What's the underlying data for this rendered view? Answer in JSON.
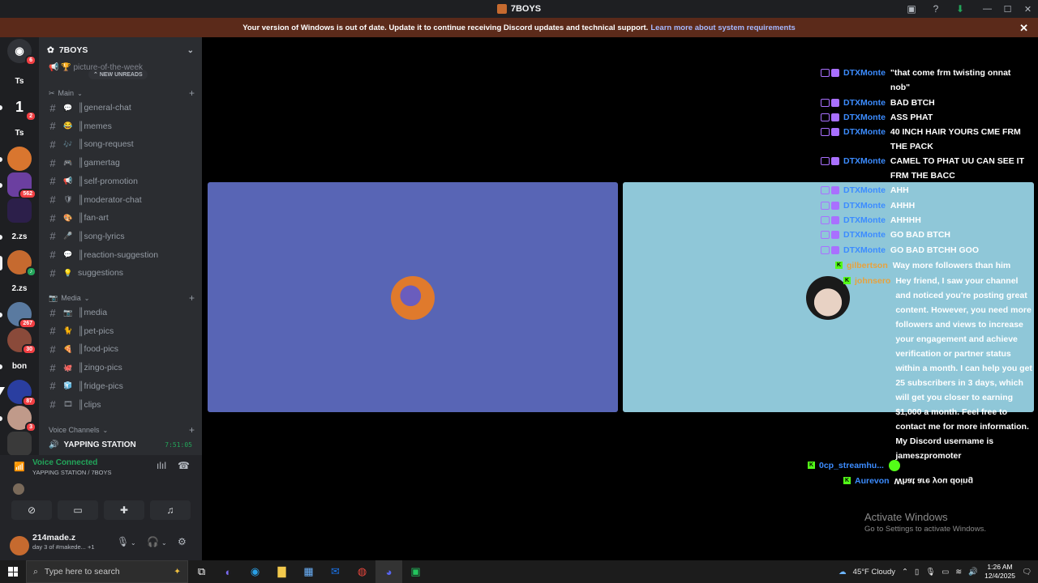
{
  "window": {
    "title": "7BOYS"
  },
  "banner": {
    "text": "Your version of Windows is out of date. Update it to continue receiving Discord updates and technical support.",
    "link": "Learn more about system requirements"
  },
  "rail": {
    "items": [
      {
        "label": "",
        "badge": "6"
      },
      {
        "label": "Ts",
        "badge": ""
      },
      {
        "label": "1",
        "badge": "2"
      },
      {
        "label": "Ts",
        "badge": ""
      },
      {
        "label": "",
        "badge": ""
      },
      {
        "label": "",
        "badge": "562"
      },
      {
        "label": "",
        "badge": ""
      },
      {
        "label": "2.zs",
        "badge": ""
      },
      {
        "label": "",
        "badge": ""
      },
      {
        "label": "2.zs",
        "badge": ""
      },
      {
        "label": "",
        "badge": "267"
      },
      {
        "label": "",
        "badge": "30"
      },
      {
        "label": "bon",
        "badge": ""
      },
      {
        "label": "",
        "badge": "87"
      },
      {
        "label": "",
        "badge": "3"
      },
      {
        "label": "",
        "badge": ""
      }
    ]
  },
  "server": {
    "name": "7BOYS",
    "prev_channel": "picture-of-the-week",
    "new_unreads": "NEW UNREADS",
    "categories": {
      "main": "Main",
      "media": "Media",
      "voice": "Voice Channels"
    },
    "main_channels": [
      {
        "emoji": "💬",
        "name": "║general-chat"
      },
      {
        "emoji": "😂",
        "name": "║memes"
      },
      {
        "emoji": "🎶",
        "name": "║song-request"
      },
      {
        "emoji": "🎮",
        "name": "║gamertag"
      },
      {
        "emoji": "📢",
        "name": "║self-promotion"
      },
      {
        "emoji": "🛡",
        "name": "║moderator-chat"
      },
      {
        "emoji": "🎨",
        "name": "║fan-art"
      },
      {
        "emoji": "🎤",
        "name": "║song-lyrics"
      },
      {
        "emoji": "💬",
        "name": "║reaction-suggestion"
      },
      {
        "emoji": "💡",
        "name": "suggestions"
      }
    ],
    "media_channels": [
      {
        "emoji": "📷",
        "name": "║media"
      },
      {
        "emoji": "🐈",
        "name": "║pet-pics"
      },
      {
        "emoji": "🍕",
        "name": "║food-pics"
      },
      {
        "emoji": "🐙",
        "name": "║zingo-pics"
      },
      {
        "emoji": "🧊",
        "name": "║fridge-pics"
      },
      {
        "emoji": "🎞",
        "name": "║clips"
      }
    ],
    "voice_channel": {
      "name": "YAPPING STATION",
      "time": "7:51:05"
    }
  },
  "voice_panel": {
    "status": "Voice Connected",
    "location": "YAPPING STATION / 7BOYS"
  },
  "user": {
    "name": "214made.z",
    "status": "day 3 of #makede...",
    "extra": "+1"
  },
  "chat": [
    {
      "platform": "twitch",
      "user": "DTXMonte",
      "text": "\"that come frm twisting onnat nob\""
    },
    {
      "platform": "twitch",
      "user": "DTXMonte",
      "text": "BAD BTCH"
    },
    {
      "platform": "twitch",
      "user": "DTXMonte",
      "text": "ASS PHAT"
    },
    {
      "platform": "twitch",
      "user": "DTXMonte",
      "text": "40 INCH HAIR YOURS CME FRM THE PACK"
    },
    {
      "platform": "twitch",
      "user": "DTXMonte",
      "text": "CAMEL TO PHAT UU CAN SEE IT FRM THE BACC"
    },
    {
      "platform": "twitch",
      "user": "DTXMonte",
      "text": "AHH"
    },
    {
      "platform": "twitch",
      "user": "DTXMonte",
      "text": "AHHH"
    },
    {
      "platform": "twitch",
      "user": "DTXMonte",
      "text": "AHHHH"
    },
    {
      "platform": "twitch",
      "user": "DTXMonte",
      "text": "GO BAD BTCH"
    },
    {
      "platform": "twitch",
      "user": "DTXMonte",
      "text": "GO BAD BTCHH GOO"
    },
    {
      "platform": "kick",
      "user": "gilbertson",
      "text": "Way more followers than him"
    },
    {
      "platform": "kick",
      "user": "johnsero",
      "text": "Hey friend, I saw your channel and noticed you're posting great content. However, you need more followers and views to increase your engagement and achieve verification or partner status within a month. I can help you get 25 subscribers in 3 days, which will get you closer to earning $1,000 a month. Feel free to contact me for more information. My Discord username is jameszpromoter"
    },
    {
      "platform": "kick",
      "user": "0cp_streamhu...",
      "text": ""
    },
    {
      "platform": "kick",
      "user": "Aurevon",
      "text": "What are you doing"
    }
  ],
  "watermark": {
    "title": "Activate Windows",
    "sub": "Go to Settings to activate Windows."
  },
  "taskbar": {
    "search_placeholder": "Type here to search",
    "weather": "45°F  Cloudy",
    "time": "1:26 AM",
    "date": "12/4/2025"
  }
}
